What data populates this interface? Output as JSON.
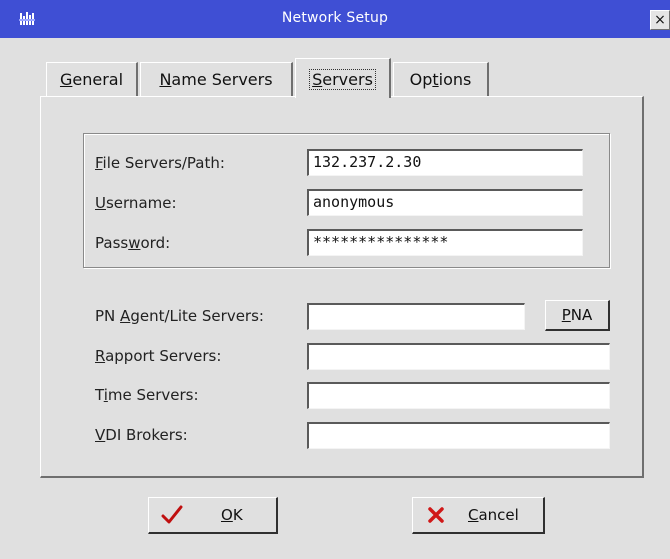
{
  "window": {
    "title": "Network Setup",
    "close_glyph": "×",
    "title_bar_color": "#3f4fd4"
  },
  "tabs": [
    {
      "pre": "",
      "mnemonic": "G",
      "post": "eneral",
      "active": false
    },
    {
      "pre": "",
      "mnemonic": "N",
      "post": "ame Servers",
      "active": false
    },
    {
      "pre": "",
      "mnemonic": "S",
      "post": "ervers",
      "active": true
    },
    {
      "pre": "Op",
      "mnemonic": "t",
      "post": "ions",
      "active": false
    }
  ],
  "servers": {
    "file_servers": {
      "pre": "",
      "mnemonic": "F",
      "post": "ile Servers/Path:",
      "value": "132.237.2.30"
    },
    "username": {
      "pre": "",
      "mnemonic": "U",
      "post": "sername:",
      "value": "anonymous"
    },
    "password": {
      "pre": "Pass",
      "mnemonic": "w",
      "post": "ord:",
      "value": "***************"
    },
    "pn_agent": {
      "pre": "PN ",
      "mnemonic": "A",
      "post": "gent/Lite Servers:",
      "value": ""
    },
    "pna_button": {
      "pre": "",
      "mnemonic": "P",
      "post": "NA"
    },
    "rapport": {
      "pre": "",
      "mnemonic": "R",
      "post": "apport Servers:",
      "value": ""
    },
    "time": {
      "pre": "T",
      "mnemonic": "i",
      "post": "me Servers:",
      "value": ""
    },
    "vdi": {
      "pre": "",
      "mnemonic": "V",
      "post": "DI Brokers:",
      "value": ""
    }
  },
  "buttons": {
    "ok": {
      "pre": "",
      "mnemonic": "O",
      "post": "K",
      "icon": "checkmark-icon",
      "icon_color": "#c01010"
    },
    "cancel": {
      "pre": "",
      "mnemonic": "C",
      "post": "ancel",
      "icon": "x-icon",
      "icon_color": "#d01818"
    }
  }
}
